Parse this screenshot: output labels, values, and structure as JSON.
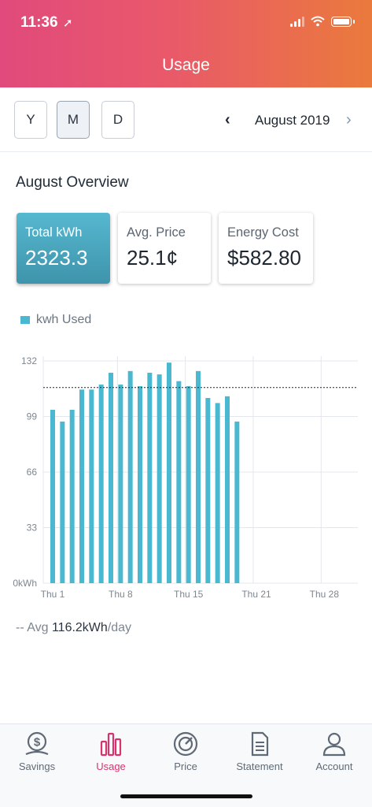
{
  "status_bar": {
    "time": "11:36",
    "location_icon": "location-arrow-icon"
  },
  "header": {
    "title": "Usage"
  },
  "period_selector": {
    "options": [
      "Y",
      "M",
      "D"
    ],
    "selected": "M"
  },
  "month_nav": {
    "label": "August 2019"
  },
  "overview": {
    "title": "August Overview",
    "cards": [
      {
        "label": "Total kWh",
        "value": "2323.3",
        "active": true
      },
      {
        "label": "Avg. Price",
        "value": "25.1¢",
        "active": false
      },
      {
        "label": "Energy Cost",
        "value": "$582.80",
        "active": false
      }
    ]
  },
  "chart_data": {
    "type": "bar",
    "legend": [
      "kwh Used"
    ],
    "series": [
      {
        "name": "kwh Used",
        "values": [
          103,
          96,
          103,
          115,
          115,
          118,
          125,
          118,
          126,
          117,
          125,
          124,
          131,
          120,
          117,
          126,
          110,
          107,
          111,
          96
        ]
      }
    ],
    "x_domain": [
      1,
      31
    ],
    "x_ticks": [
      {
        "day": 1,
        "label": "Thu 1"
      },
      {
        "day": 8,
        "label": "Thu 8"
      },
      {
        "day": 15,
        "label": "Thu 15"
      },
      {
        "day": 22,
        "label": "Thu 21"
      },
      {
        "day": 29,
        "label": "Thu 28"
      }
    ],
    "y_ticks": [
      {
        "value": 0,
        "label": "0kWh"
      },
      {
        "value": 33,
        "label": "33"
      },
      {
        "value": 66,
        "label": "66"
      },
      {
        "value": 99,
        "label": "99"
      },
      {
        "value": 132,
        "label": "132"
      }
    ],
    "ylim": [
      0,
      132
    ],
    "average_line": 116.2,
    "bar_color": "#4ab8d0",
    "grid": true
  },
  "average": {
    "prefix": "-- Avg",
    "value": "116.2kWh",
    "suffix": "/day"
  },
  "tabs": [
    {
      "label": "Savings",
      "icon": "savings-coin-icon"
    },
    {
      "label": "Usage",
      "icon": "usage-bars-icon",
      "active": true
    },
    {
      "label": "Price",
      "icon": "price-gauge-icon"
    },
    {
      "label": "Statement",
      "icon": "statement-document-icon"
    },
    {
      "label": "Account",
      "icon": "account-person-icon"
    }
  ],
  "colors": {
    "accent": "#d9336e",
    "bar": "#4ab8d0",
    "card_active": "#4aa6bd"
  }
}
